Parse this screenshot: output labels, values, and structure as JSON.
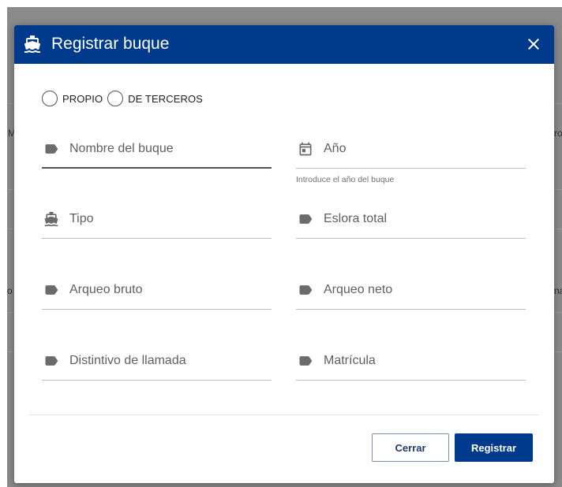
{
  "background": {
    "fragments": [
      "M",
      "ro",
      "o",
      "na"
    ]
  },
  "dialog": {
    "title": "Registrar buque",
    "title_icon": "ship-icon",
    "close_icon": "close-icon",
    "header_color": "#003a8c"
  },
  "ownership": {
    "options": [
      {
        "label": "PROPIO",
        "selected": false
      },
      {
        "label": "DE TERCEROS",
        "selected": false
      }
    ]
  },
  "fields": {
    "nombre": {
      "label": "Nombre del buque",
      "icon": "label-icon",
      "value": ""
    },
    "anio": {
      "label": "Año",
      "icon": "calendar-icon",
      "value": "",
      "hint": "Introduce el año del buque"
    },
    "tipo": {
      "label": "Tipo",
      "icon": "ship-icon",
      "value": ""
    },
    "eslora": {
      "label": "Eslora total",
      "icon": "label-icon",
      "value": ""
    },
    "arqueo_bruto": {
      "label": "Arqueo bruto",
      "icon": "label-icon",
      "value": ""
    },
    "arqueo_neto": {
      "label": "Arqueo neto",
      "icon": "label-icon",
      "value": ""
    },
    "distintivo": {
      "label": "Distintivo de llamada",
      "icon": "label-icon",
      "value": ""
    },
    "matricula": {
      "label": "Matrícula",
      "icon": "label-icon",
      "value": ""
    }
  },
  "actions": {
    "close_label": "Cerrar",
    "register_label": "Registrar"
  }
}
